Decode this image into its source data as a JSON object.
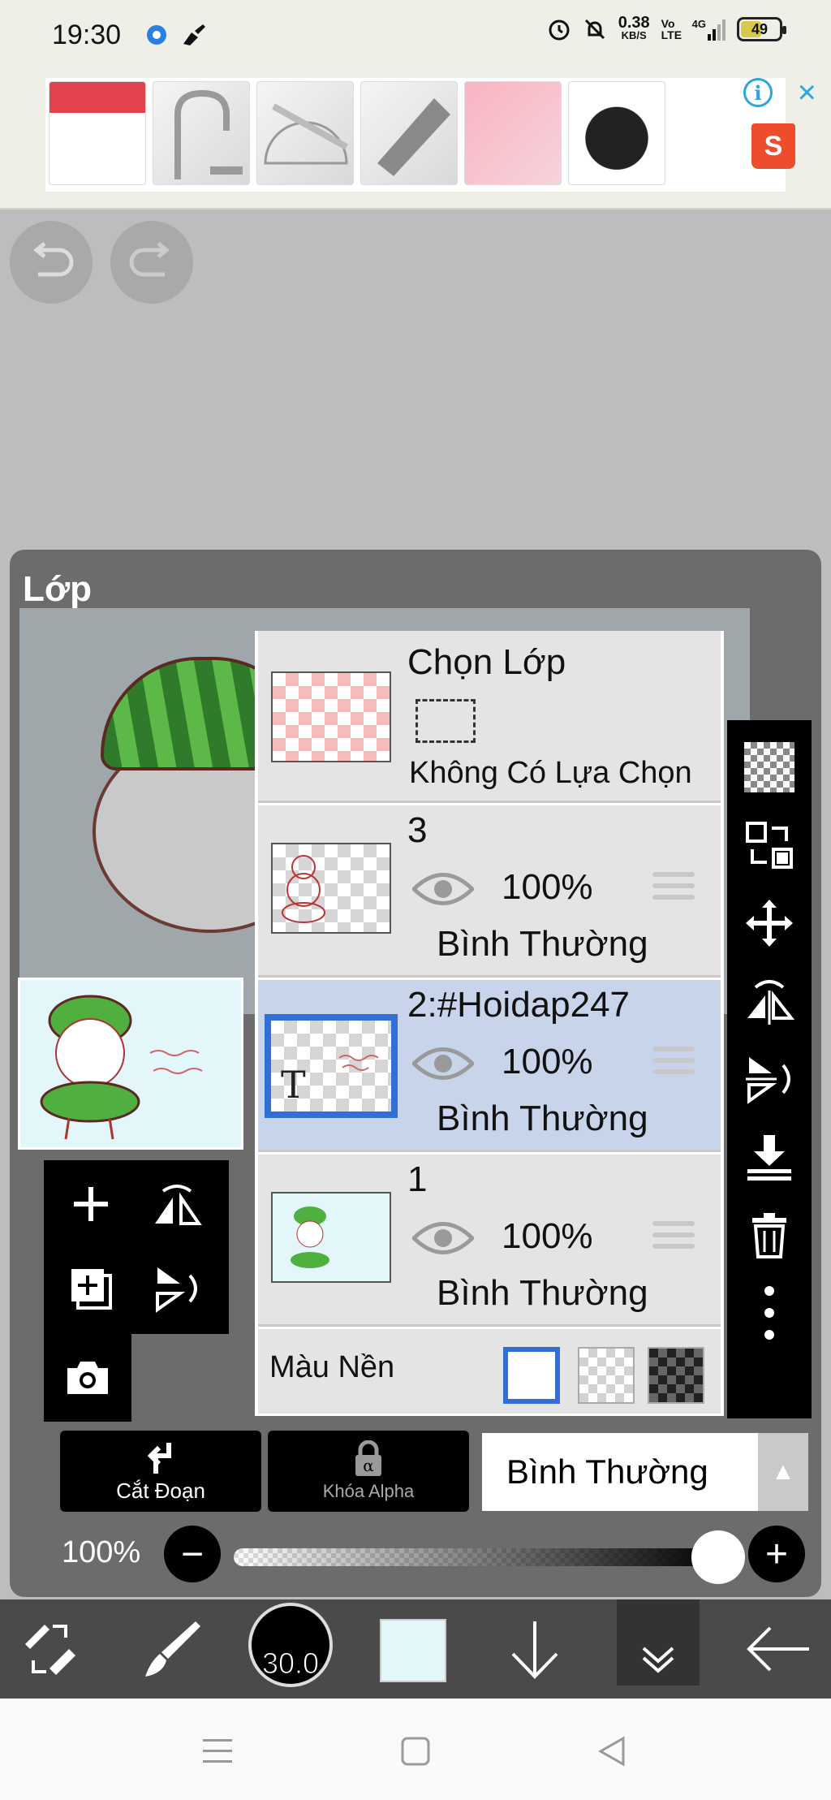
{
  "status_bar": {
    "time": "19:30",
    "speed_value": "0.38",
    "speed_unit": "KB/S",
    "volte": "Vo LTE",
    "network": "4G",
    "battery": "49"
  },
  "ad": {
    "info_icon": "info-icon",
    "close_icon": "close-icon",
    "shop_icon": "shopee-bag-icon",
    "shop_letter": "S"
  },
  "panel": {
    "title": "Lớp",
    "selection_layer": {
      "name": "Chọn Lớp",
      "status": "Không Có Lựa Chọn"
    },
    "layers": [
      {
        "name": "3",
        "opacity": "100%",
        "blend": "Bình Thường"
      },
      {
        "name": "2:#Hoidap247",
        "opacity": "100%",
        "blend": "Bình Thường",
        "thumb_letter": "T"
      },
      {
        "name": "1",
        "opacity": "100%",
        "blend": "Bình Thường"
      }
    ],
    "background": {
      "label": "Màu Nền"
    },
    "clipping_label": "Cắt Đoạn",
    "alpha_lock_label": "Khóa Alpha",
    "blend_mode": "Bình Thường",
    "opacity_label": "100%",
    "opacity": 1.0,
    "blend_arrow": "▲"
  },
  "toolbar": {
    "brush_size": "30.0",
    "current_color": "#e3f7fb"
  },
  "colors": {
    "accent": "#2f6fd6",
    "selected_layer_bg": "#c7d4ea"
  }
}
